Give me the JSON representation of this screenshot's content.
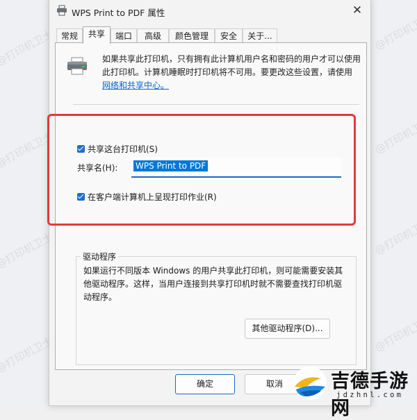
{
  "window": {
    "title": "WPS Print to PDF 属性"
  },
  "tabs": [
    "常规",
    "共享",
    "端口",
    "高级",
    "颜色管理",
    "安全",
    "关于..."
  ],
  "active_tab": "共享",
  "info": {
    "text": "如果共享此打印机，只有拥有此计算机用户名和密码的用户才可以使用此打印机。计算机睡眠时打印机将不可用。要更改这些设置，请使用",
    "link": "网络和共享中心。"
  },
  "share": {
    "share_printer_label": "共享这台打印机(S)",
    "share_printer_checked": true,
    "share_name_label": "共享名(H):",
    "share_name_value": "WPS Print to PDF",
    "render_client_label": "在客户端计算机上呈现打印作业(R)",
    "render_client_checked": true
  },
  "driver": {
    "legend": "驱动程序",
    "text": "如果运行不同版本 Windows 的用户共享此打印机，则可能需要安装其他驱动程序。这样，当用户连接到共享打印机时就不需要查找打印机驱动程序。",
    "button": "其他驱动程序(D)..."
  },
  "buttons": {
    "ok": "确定",
    "cancel": "取消"
  },
  "watermark": "@打印机卫士",
  "brand": {
    "name": "吉德手游网",
    "domain": "jdzhnl.com"
  },
  "colors": {
    "accent": "#1b66c9",
    "highlight": "#e2393b"
  },
  "icons": {
    "printer": "printer-icon",
    "close": "close-icon"
  }
}
